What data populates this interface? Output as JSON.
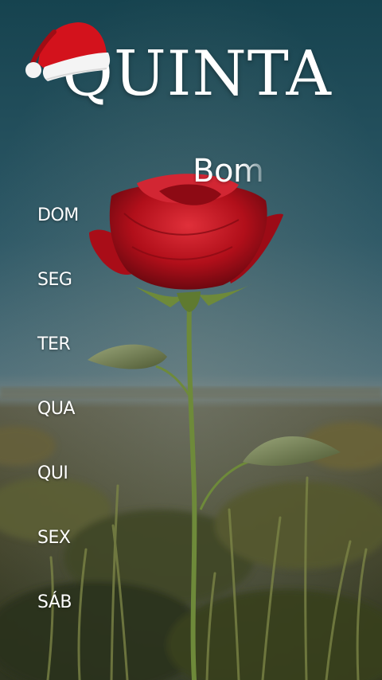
{
  "header": {
    "title": "QUINTA",
    "greeting": "Bom"
  },
  "days": [
    {
      "label": "DOM"
    },
    {
      "label": "SEG"
    },
    {
      "label": "TER"
    },
    {
      "label": "QUA"
    },
    {
      "label": "QUI"
    },
    {
      "label": "SEX"
    },
    {
      "label": "SÁB"
    }
  ],
  "icons": {
    "hat": "santa-hat-icon",
    "flower": "red-rose-image"
  },
  "colors": {
    "sky_top": "#1a4e5b",
    "sky_bottom": "#5d7a84",
    "rose": "#c0121c",
    "text": "#ffffff"
  }
}
